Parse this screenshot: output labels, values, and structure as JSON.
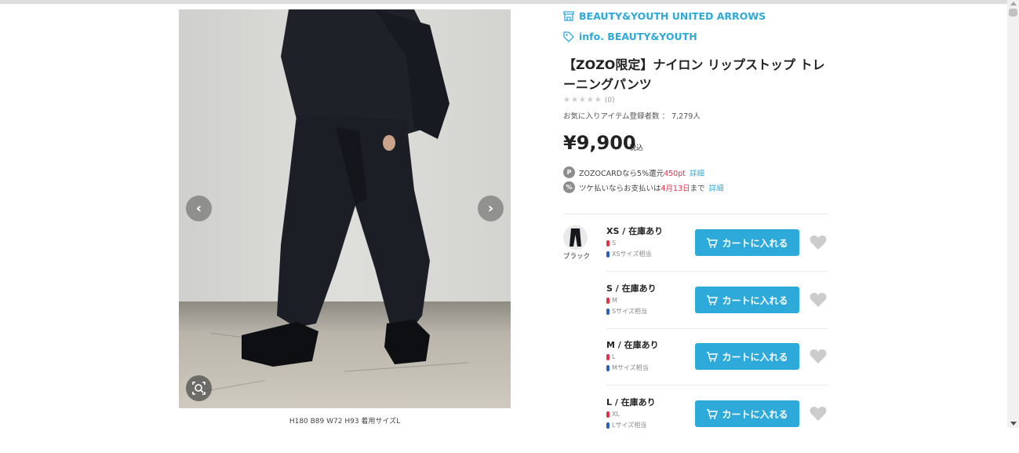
{
  "shop": {
    "brand": "BEAUTY&YOUTH UNITED ARROWS",
    "info": "info. BEAUTY&YOUTH"
  },
  "product": {
    "title": "【ZOZO限定】ナイロン リップストップ トレーニングパンツ",
    "rating": {
      "stars": "★★★★★",
      "count": "(0)"
    },
    "favorites": "お気に入りアイテム登録者数 ： 7,279人",
    "price": "¥9,900",
    "tax": "税込"
  },
  "points": [
    {
      "icon": "P",
      "prefix": "ZOZOCARDなら5%還元",
      "highlight": "450pt",
      "suffix": "",
      "link": "詳細"
    },
    {
      "icon": "%",
      "prefix": "ツケ払いならお支払いは",
      "highlight": "4月13日",
      "suffix": "まで",
      "link": "詳細"
    }
  ],
  "gallery": {
    "caption": "H180 B89 W72 H93 着用サイズL",
    "prev": "‹",
    "next": "›"
  },
  "color": {
    "name": "ブラック"
  },
  "sizes": [
    {
      "size": "XS / 在庫あり",
      "fit_female": "S",
      "fit_male": "XSサイズ相当",
      "cart_label": "カートに入れる"
    },
    {
      "size": "S / 在庫あり",
      "fit_female": "M",
      "fit_male": "Sサイズ相当",
      "cart_label": "カートに入れる"
    },
    {
      "size": "M / 在庫あり",
      "fit_female": "L",
      "fit_male": "Mサイズ相当",
      "cart_label": "カートに入れる"
    },
    {
      "size": "L / 在庫あり",
      "fit_female": "XL",
      "fit_male": "Lサイズ相当",
      "cart_label": "カートに入れる"
    }
  ],
  "colors": {
    "accent": "#2da9da",
    "highlight": "#e0334a",
    "heart": "#cccccc"
  }
}
